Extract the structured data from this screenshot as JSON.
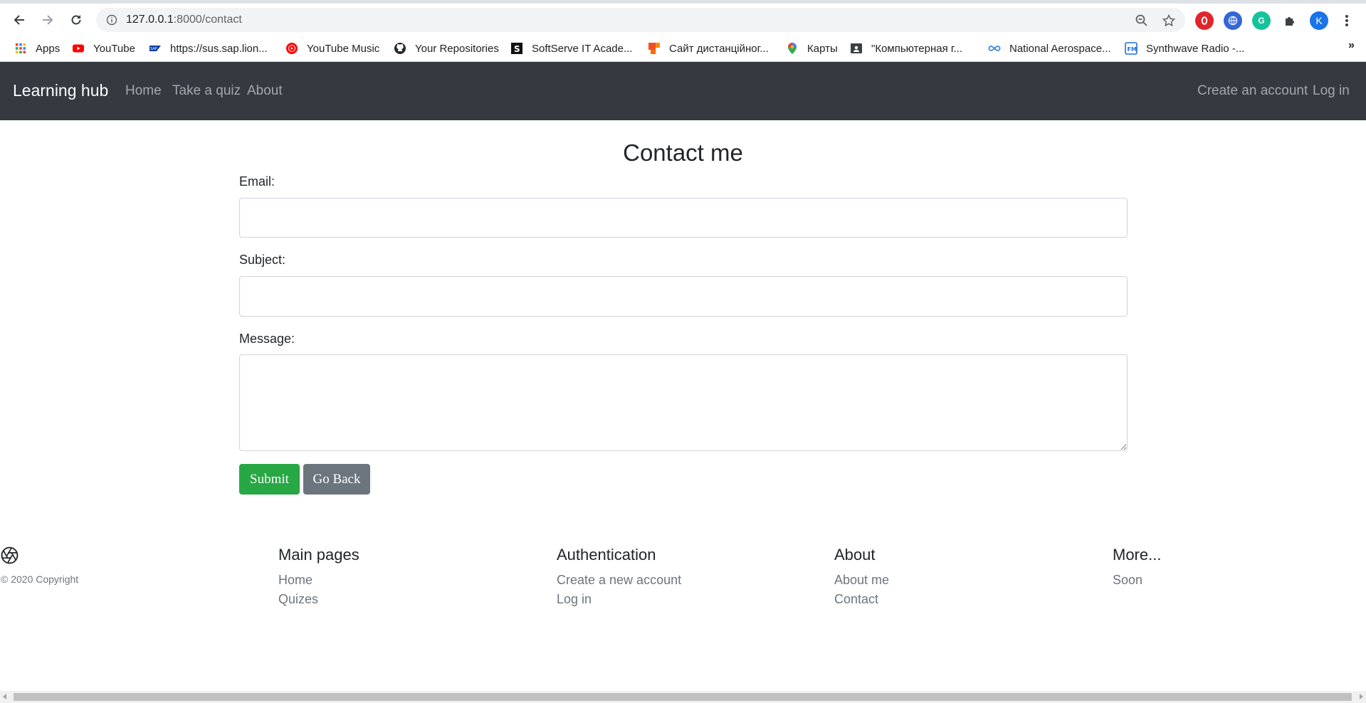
{
  "browser": {
    "url_host": "127.0.0.1",
    "url_path": ":8000/contact",
    "profile_initial": "K",
    "bookmarks": [
      {
        "label": "Apps",
        "icon": "apps-grid-icon"
      },
      {
        "label": "YouTube",
        "icon": "youtube-icon"
      },
      {
        "label": "https://sus.sap.lion...",
        "icon": "sap-icon"
      },
      {
        "label": "YouTube Music",
        "icon": "youtube-music-icon"
      },
      {
        "label": "Your Repositories",
        "icon": "github-icon"
      },
      {
        "label": "SoftServe IT Acade...",
        "icon": "softserve-icon"
      },
      {
        "label": "Сайт дистанційног...",
        "icon": "office-icon"
      },
      {
        "label": "Карты",
        "icon": "maps-pin-icon"
      },
      {
        "label": "\"Компьютерная г...",
        "icon": "classroom-icon"
      },
      {
        "label": "National Aerospace...",
        "icon": "infinity-icon"
      },
      {
        "label": "Synthwave Radio -...",
        "icon": "radio-icon"
      }
    ],
    "bookmarks_more": "»"
  },
  "navbar": {
    "brand": "Learning hub",
    "links": [
      "Home",
      "Take a quiz",
      "About"
    ],
    "right_links": [
      "Create an account",
      "Log in"
    ]
  },
  "contact": {
    "title": "Contact me",
    "email_label": "Email:",
    "subject_label": "Subject:",
    "message_label": "Message:",
    "email_value": "",
    "subject_value": "",
    "message_value": "",
    "submit_label": "Submit",
    "back_label": "Go Back"
  },
  "footer": {
    "copyright": "© 2020 Copyright",
    "columns": [
      {
        "heading": "Main pages",
        "links": [
          "Home",
          "Quizes"
        ]
      },
      {
        "heading": "Authentication",
        "links": [
          "Create a new account",
          "Log in"
        ]
      },
      {
        "heading": "About",
        "links": [
          "About me",
          "Contact"
        ]
      },
      {
        "heading": "More...",
        "links": [
          "Soon"
        ]
      }
    ]
  },
  "colors": {
    "navbar_bg": "#343a40",
    "submit_bg": "#28a745",
    "back_bg": "#6c757d",
    "muted_text": "#6c757d"
  }
}
